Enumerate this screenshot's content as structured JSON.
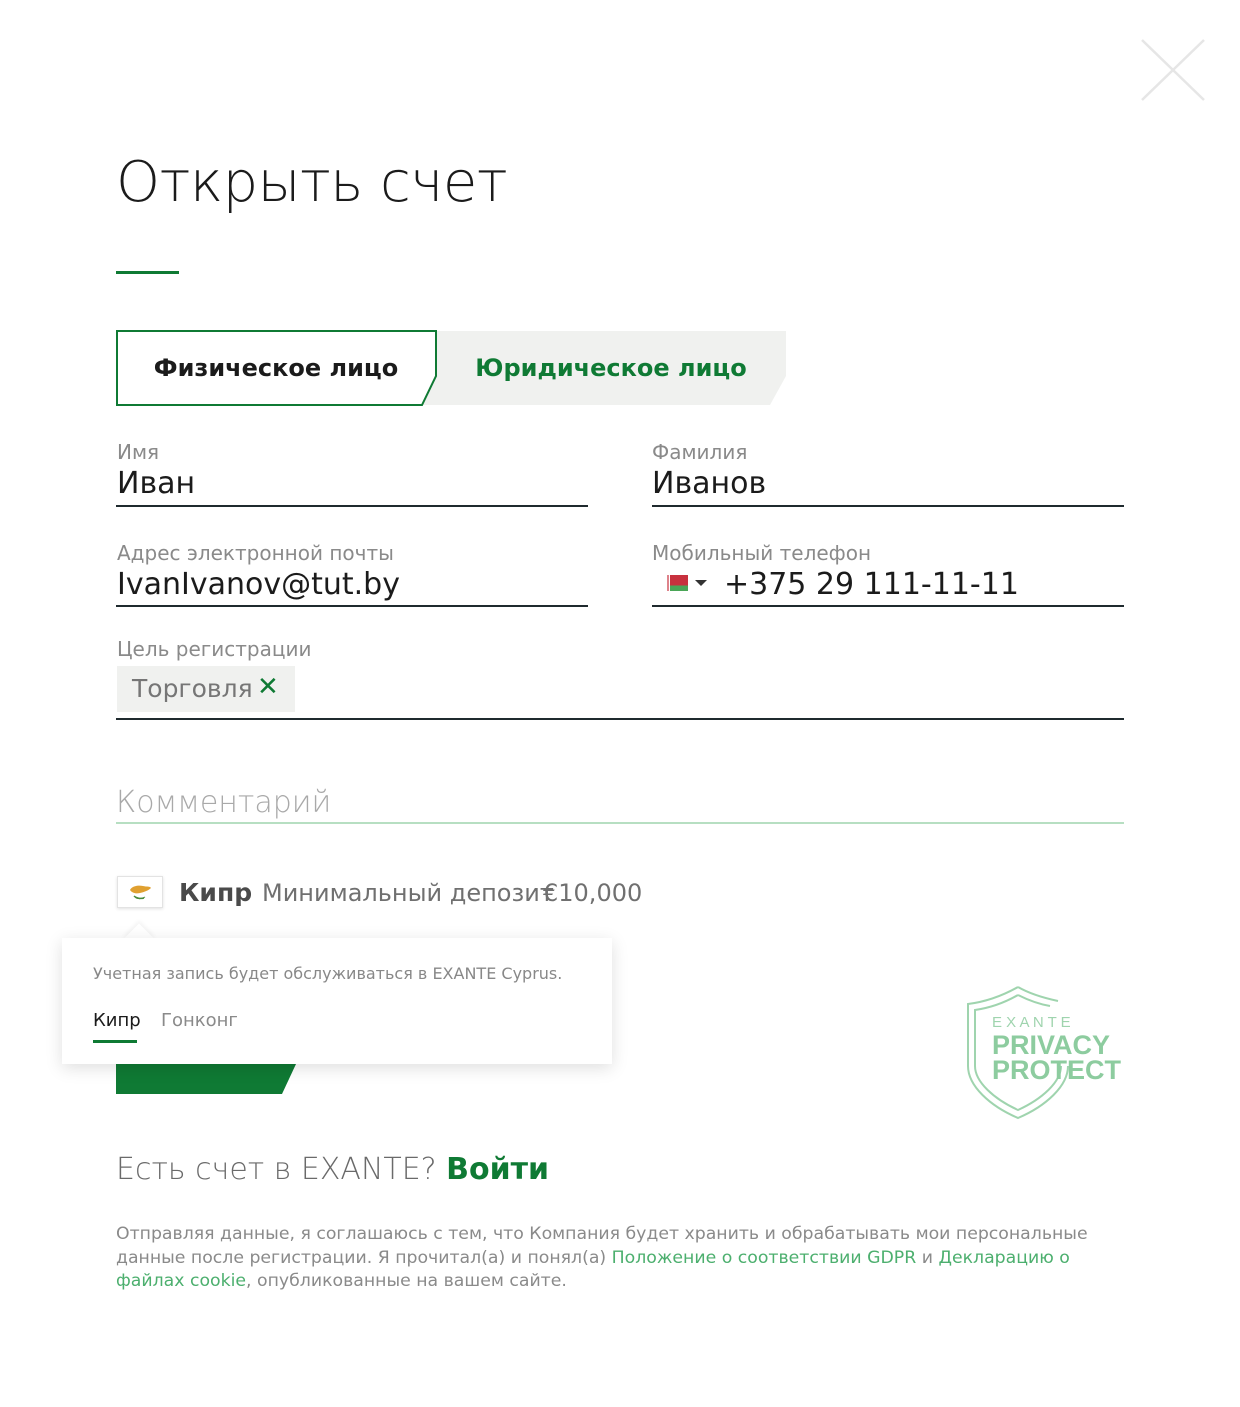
{
  "page": {
    "title": "Открыть счет",
    "close_icon": "close-icon"
  },
  "account_type_tabs": [
    {
      "label": "Физическое лицо",
      "active": true
    },
    {
      "label": "Юридическое лицо",
      "active": false
    }
  ],
  "form": {
    "first_name": {
      "label": "Имя",
      "value": "Иван"
    },
    "last_name": {
      "label": "Фамилия",
      "value": "Иванов"
    },
    "email": {
      "label": "Адрес электронной почты",
      "value": "IvanIvanov@tut.by"
    },
    "phone": {
      "label": "Мобильный телефон",
      "value": "+375 29 111-11-11",
      "country_flag_icon": "belarus-flag-icon"
    },
    "purpose": {
      "label": "Цель регистрации",
      "tags": [
        "Торговля"
      ],
      "remove_icon": "close-icon"
    },
    "comment": {
      "placeholder": "Комментарий",
      "value": ""
    }
  },
  "jurisdiction": {
    "flag_icon": "cyprus-flag-icon",
    "country": "Кипр",
    "deposit_label": "Минимальный депозит",
    "deposit_value": "€10,000"
  },
  "jurisdiction_popover": {
    "text": "Учетная запись будет обслуживаться в EXANTE Cyprus.",
    "tabs": [
      {
        "label": "Кипр",
        "active": true
      },
      {
        "label": "Гонконг",
        "active": false
      }
    ]
  },
  "privacy_badge": {
    "line1": "E X A N T E",
    "line2": "PRIVACY",
    "line3": "PROTECT"
  },
  "login": {
    "question": "Есть счет в EXANTE?",
    "link": "Войти"
  },
  "consent": {
    "text_1": "Отправляя данные, я соглашаюсь с тем, что Компания будет хранить и обрабатывать мои персональные данные после регистрации. Я прочитал(а) и понял(а)",
    "link_gdpr": "Положение о соответствии GDPR",
    "text_2": "и",
    "link_cookie": "Декларацию о файлах cookie",
    "text_3": ", опубликованные на вашем сайте."
  },
  "colors": {
    "brand_green": "#0f7a34",
    "light_green": "#4caf6e",
    "tab_inactive_bg": "#f0f1ef"
  }
}
